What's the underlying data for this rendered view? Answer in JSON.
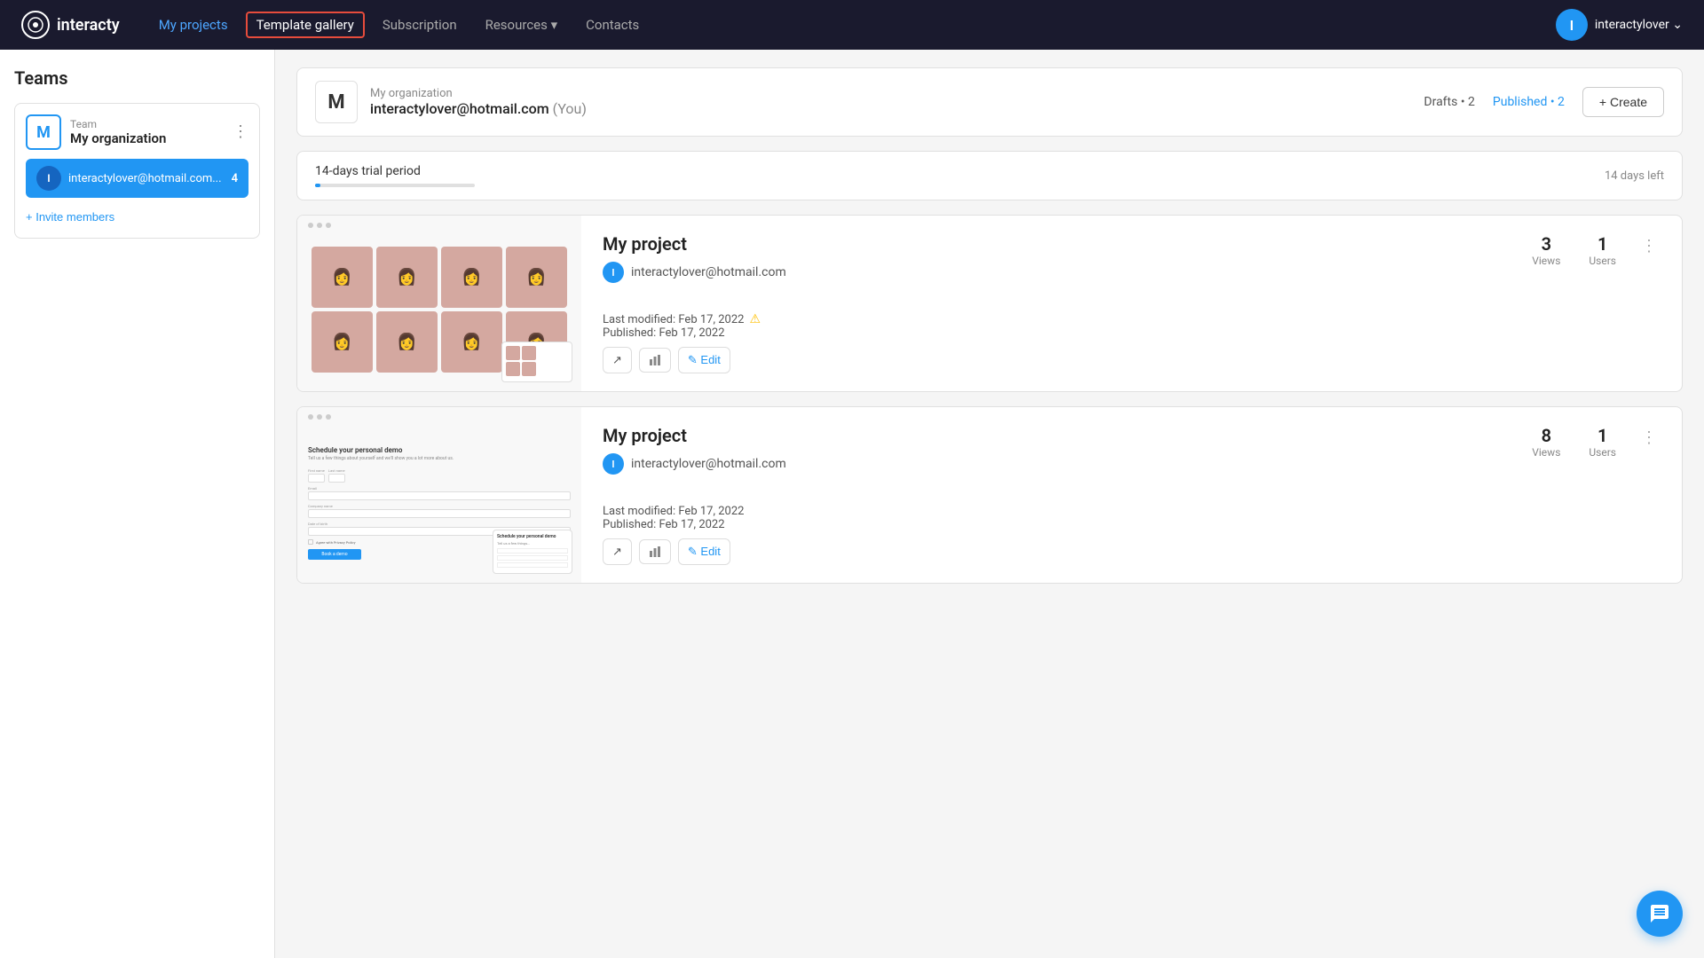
{
  "brand": {
    "name": "interacty",
    "icon_label": "I"
  },
  "navbar": {
    "links": [
      {
        "label": "My projects",
        "id": "my-projects",
        "style": "active-nav"
      },
      {
        "label": "Template gallery",
        "id": "template-gallery",
        "style": "highlighted"
      },
      {
        "label": "Subscription",
        "id": "subscription",
        "style": ""
      },
      {
        "label": "Resources ▾",
        "id": "resources",
        "style": ""
      },
      {
        "label": "Contacts",
        "id": "contacts",
        "style": ""
      }
    ],
    "user": {
      "avatar_letter": "I",
      "name": "interactylover",
      "chevron": "⌄"
    }
  },
  "sidebar": {
    "title": "Teams",
    "team": {
      "avatar_letter": "M",
      "label": "Team",
      "org_name": "My organization",
      "more_icon": "⋮"
    },
    "member": {
      "avatar_letter": "I",
      "email": "interactylover@hotmail.com...",
      "count": "4"
    },
    "invite_label": "+ Invite members"
  },
  "org_header": {
    "avatar_letter": "M",
    "org_name": "My organization",
    "email": "interactylover@hotmail.com",
    "you_label": "(You)",
    "drafts_label": "Drafts • 2",
    "published_label": "Published • 2",
    "create_label": "+ Create"
  },
  "trial": {
    "text": "14-days trial period",
    "days_left": "14 days left"
  },
  "projects": [
    {
      "id": "project-1",
      "title": "My project",
      "owner_letter": "I",
      "owner_email": "interactylover@hotmail.com",
      "views": "3",
      "views_label": "Views",
      "users": "1",
      "users_label": "Users",
      "last_modified": "Last modified: Feb 17, 2022",
      "published": "Published: Feb 17, 2022",
      "has_warning": true,
      "type": "photo-grid",
      "menu_icon": "⋮",
      "actions": {
        "external_label": "↗",
        "stats_label": "▦",
        "edit_label": "✎ Edit"
      }
    },
    {
      "id": "project-2",
      "title": "My project",
      "owner_letter": "I",
      "owner_email": "interactylover@hotmail.com",
      "views": "8",
      "views_label": "Views",
      "users": "1",
      "users_label": "Users",
      "last_modified": "Last modified: Feb 17, 2022",
      "published": "Published: Feb 17, 2022",
      "has_warning": false,
      "type": "schedule-form",
      "menu_icon": "⋮",
      "actions": {
        "external_label": "↗",
        "stats_label": "▦",
        "edit_label": "✎ Edit"
      }
    }
  ]
}
